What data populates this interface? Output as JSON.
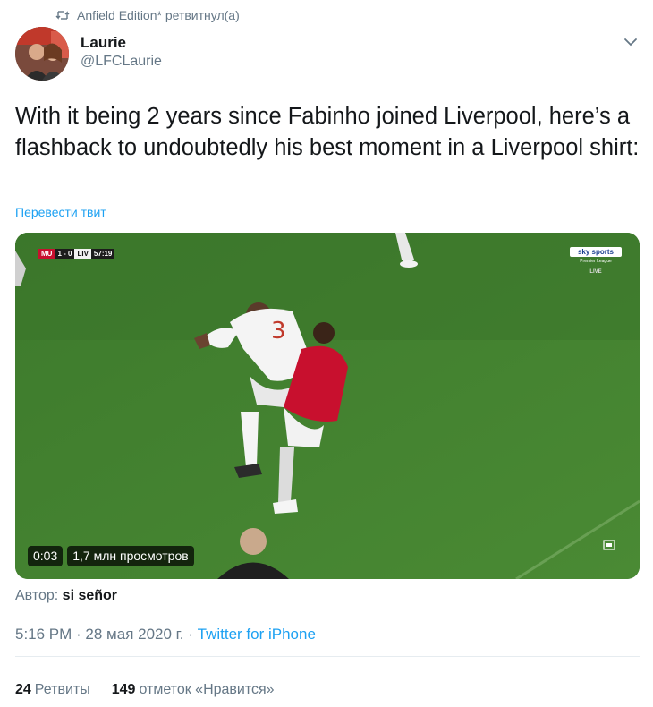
{
  "retweet_context": {
    "text": "Anfield Edition* ретвитнул(а)",
    "icon": "retweet-icon"
  },
  "author": {
    "name": "Laurie",
    "handle": "@LFCLaurie"
  },
  "tweet": {
    "text": "With it being 2 years since Fabinho joined Liverpool, here’s a flashback to undoubtedly his best moment in a Liverpool shirt:",
    "translate_label": "Перевести твит"
  },
  "video": {
    "scorebug": {
      "home": "MU",
      "score": "1 - 0",
      "away": "LIV",
      "clock": "57:19"
    },
    "broadcaster": {
      "logo": "sky sports",
      "league": "Premier League",
      "live": "LIVE"
    },
    "duration": "0:03",
    "views": "1,7 млн просмотров",
    "colors": {
      "pitch": "#3f7a2e",
      "home_kit": "#c8102e",
      "away_kit": "#ffffff"
    }
  },
  "attribution": {
    "prefix": "Автор:",
    "name": "si señor"
  },
  "meta": {
    "time_date": "5:16 PM · 28 мая 2020 г. · ",
    "source": "Twitter for iPhone"
  },
  "stats": {
    "retweets_count": "24",
    "retweets_label": "Ретвиты",
    "likes_count": "149",
    "likes_label": "отметок «Нравится»"
  }
}
